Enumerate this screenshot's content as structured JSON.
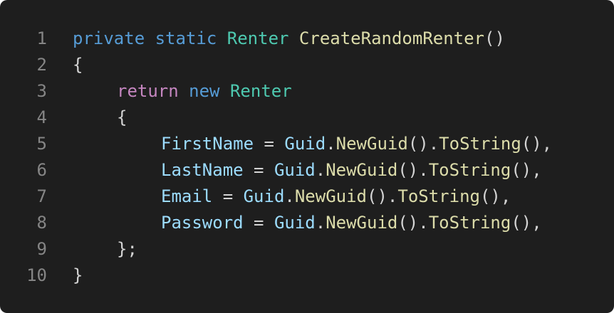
{
  "editor": {
    "lines": [
      {
        "number": "1",
        "tokens": [
          {
            "text": "private",
            "kind": "keyword"
          },
          {
            "text": " "
          },
          {
            "text": "static",
            "kind": "keyword"
          },
          {
            "text": " "
          },
          {
            "text": "Renter",
            "kind": "type"
          },
          {
            "text": " "
          },
          {
            "text": "CreateRandomRenter",
            "kind": "function"
          },
          {
            "text": "()"
          }
        ]
      },
      {
        "number": "2",
        "tokens": [
          {
            "text": "{"
          }
        ]
      },
      {
        "number": "3",
        "tokens": [
          {
            "text": "return",
            "kind": "control"
          },
          {
            "text": " "
          },
          {
            "text": "new",
            "kind": "keyword"
          },
          {
            "text": " "
          },
          {
            "text": "Renter",
            "kind": "type"
          }
        ]
      },
      {
        "number": "4",
        "tokens": [
          {
            "text": "{"
          }
        ]
      },
      {
        "number": "5",
        "tokens": [
          {
            "text": "FirstName",
            "kind": "property"
          },
          {
            "text": " = "
          },
          {
            "text": "Guid",
            "kind": "property"
          },
          {
            "text": "."
          },
          {
            "text": "NewGuid",
            "kind": "function"
          },
          {
            "text": "()."
          },
          {
            "text": "ToString",
            "kind": "function"
          },
          {
            "text": "(),"
          }
        ]
      },
      {
        "number": "6",
        "tokens": [
          {
            "text": "LastName",
            "kind": "property"
          },
          {
            "text": " = "
          },
          {
            "text": "Guid",
            "kind": "property"
          },
          {
            "text": "."
          },
          {
            "text": "NewGuid",
            "kind": "function"
          },
          {
            "text": "()."
          },
          {
            "text": "ToString",
            "kind": "function"
          },
          {
            "text": "(),"
          }
        ]
      },
      {
        "number": "7",
        "tokens": [
          {
            "text": "Email",
            "kind": "property"
          },
          {
            "text": " = "
          },
          {
            "text": "Guid",
            "kind": "property"
          },
          {
            "text": "."
          },
          {
            "text": "NewGuid",
            "kind": "function"
          },
          {
            "text": "()."
          },
          {
            "text": "ToString",
            "kind": "function"
          },
          {
            "text": "(),"
          }
        ]
      },
      {
        "number": "8",
        "tokens": [
          {
            "text": "Password",
            "kind": "property"
          },
          {
            "text": " = "
          },
          {
            "text": "Guid",
            "kind": "property"
          },
          {
            "text": "."
          },
          {
            "text": "NewGuid",
            "kind": "function"
          },
          {
            "text": "()."
          },
          {
            "text": "ToString",
            "kind": "function"
          },
          {
            "text": "(),"
          }
        ]
      },
      {
        "number": "9",
        "tokens": [
          {
            "text": "};"
          }
        ]
      },
      {
        "number": "10",
        "tokens": [
          {
            "text": "}"
          }
        ]
      }
    ],
    "colors": {
      "background": "#1e1e1e",
      "line_number": "#858585",
      "default": "#d4d4d4",
      "keyword": "#569cd6",
      "control": "#c586c0",
      "type": "#4ec9b0",
      "function": "#dcdcaa",
      "property": "#9cdcfe"
    }
  }
}
